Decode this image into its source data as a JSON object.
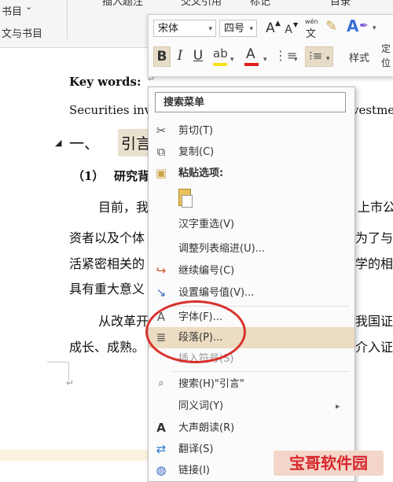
{
  "ribbon": {
    "top_left": "书目",
    "top_left_arrow": "⌄",
    "second_left": "文与书目",
    "partial_1": "插入题注",
    "partial_2": "交叉引用",
    "partial_3": "标记",
    "partial_4": "目录"
  },
  "mini_toolbar": {
    "font_name": "宋体",
    "font_size": "四号",
    "grow_font": "A",
    "shrink_font": "A",
    "phonetic_top": "wén",
    "phonetic_char": "文",
    "bold": "B",
    "italic": "I",
    "underline": "U",
    "styles_label": "样式",
    "partial_right": "定",
    "partial_right2": "位"
  },
  "document": {
    "keywords_label": "Key words",
    "keywords_colon": ":",
    "securities_line_left": "Securities inv",
    "securities_line_right": "vestme",
    "heading_num": "一、",
    "heading_text": "引言",
    "sub_heading_num": "（1）",
    "sub_heading_text": "研究背",
    "para1_line1_left": "目前，我",
    "para1_line1_right": "上市公",
    "para1_line2_left": "资者以及个体",
    "para1_line2_right": "为了与",
    "para1_line3_left": "活紧密相关的",
    "para1_line3_right": "学的相",
    "para1_line4_left": "具有重大意义",
    "para2_line1_left": "从改革开",
    "para2_line1_right": "我国证",
    "para2_line2_left": "成长、成熟。",
    "para2_line2_right": "介入证"
  },
  "context_menu": {
    "search_label": "搜索菜单",
    "items": [
      {
        "label": "剪切(T)",
        "icon": "scissors-icon",
        "glyph": "✂"
      },
      {
        "label": "复制(C)",
        "icon": "copy-icon",
        "glyph": "⧉"
      },
      {
        "label": "粘贴选项:",
        "icon": "paste-icon",
        "glyph": "📋"
      },
      {
        "label": "",
        "icon": "paste-keep-text-icon",
        "glyph": ""
      },
      {
        "label": "汉字重选(V)",
        "icon": "",
        "glyph": ""
      },
      {
        "label": "调整列表缩进(U)...",
        "icon": "",
        "glyph": ""
      },
      {
        "label": "继续编号(C)",
        "icon": "continue-numbering-icon",
        "glyph": "↪"
      },
      {
        "label": "设置编号值(V)...",
        "icon": "set-numbering-value-icon",
        "glyph": "↘"
      },
      {
        "label": "字体(F)...",
        "icon": "font-icon",
        "glyph": "A"
      },
      {
        "label": "段落(P)...",
        "icon": "paragraph-icon",
        "glyph": "≣"
      },
      {
        "label": "插入符号(S)",
        "icon": "",
        "glyph": ""
      },
      {
        "label": "搜索(H)\"引言\"",
        "icon": "search-icon",
        "glyph": "🔍"
      },
      {
        "label": "同义词(Y)",
        "icon": "",
        "glyph": ""
      },
      {
        "label": "大声朗读(R)",
        "icon": "read-aloud-icon",
        "glyph": "A"
      },
      {
        "label": "翻译(S)",
        "icon": "translate-icon",
        "glyph": "⇄"
      },
      {
        "label": "链接(I)",
        "icon": "link-icon",
        "glyph": "🌐"
      }
    ],
    "submenu_arrow": "▸"
  },
  "watermark": {
    "text": "宝哥软件园"
  },
  "colors": {
    "highlight": "#ecdcc2",
    "circle": "#d8322d",
    "font_color_red": "#e02020",
    "highlight_yellow": "#f5e21a"
  }
}
